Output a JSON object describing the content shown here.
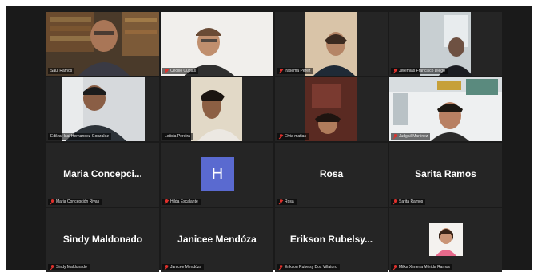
{
  "participants": [
    {
      "name": "Saul Ramos",
      "muted": false
    },
    {
      "name": "Cecilio Cudias",
      "muted": true
    },
    {
      "name": "Irasema Perez",
      "muted": true
    },
    {
      "name": "Jeremias Francisco Diego",
      "muted": true
    },
    {
      "name": "Edilzar Isai Hernandez Gonzalez",
      "muted": false
    },
    {
      "name": "Leticia Pereira",
      "muted": false
    },
    {
      "name": "Elvia matias",
      "muted": true
    },
    {
      "name": "Judgail Martinez",
      "muted": true
    },
    {
      "name": "Maria Concepción Rivas",
      "display": "Maria  Concepci...",
      "muted": true
    },
    {
      "name": "Hilda Escalante",
      "avatar_letter": "H",
      "muted": true
    },
    {
      "name": "Rosa",
      "display": "Rosa",
      "muted": true
    },
    {
      "name": "Sarita Ramos",
      "display": "Sarita Ramos",
      "muted": true
    },
    {
      "name": "Sindy Maldonado",
      "display": "Sindy Maldonado",
      "muted": true
    },
    {
      "name": "Janicee Mendóza",
      "display": "Janicee Mendóza",
      "muted": true
    },
    {
      "name": "Erikson Rubelsy Dox Villatoro",
      "display": "Erikson  Rubelsy...",
      "muted": true
    },
    {
      "name": "Milka Ximena Mérida Ramos",
      "muted": true
    }
  ],
  "colors": {
    "active_speaker": "#d6dc48",
    "muted_icon": "#e0312c",
    "avatar_bg": "#5a6ad0"
  }
}
